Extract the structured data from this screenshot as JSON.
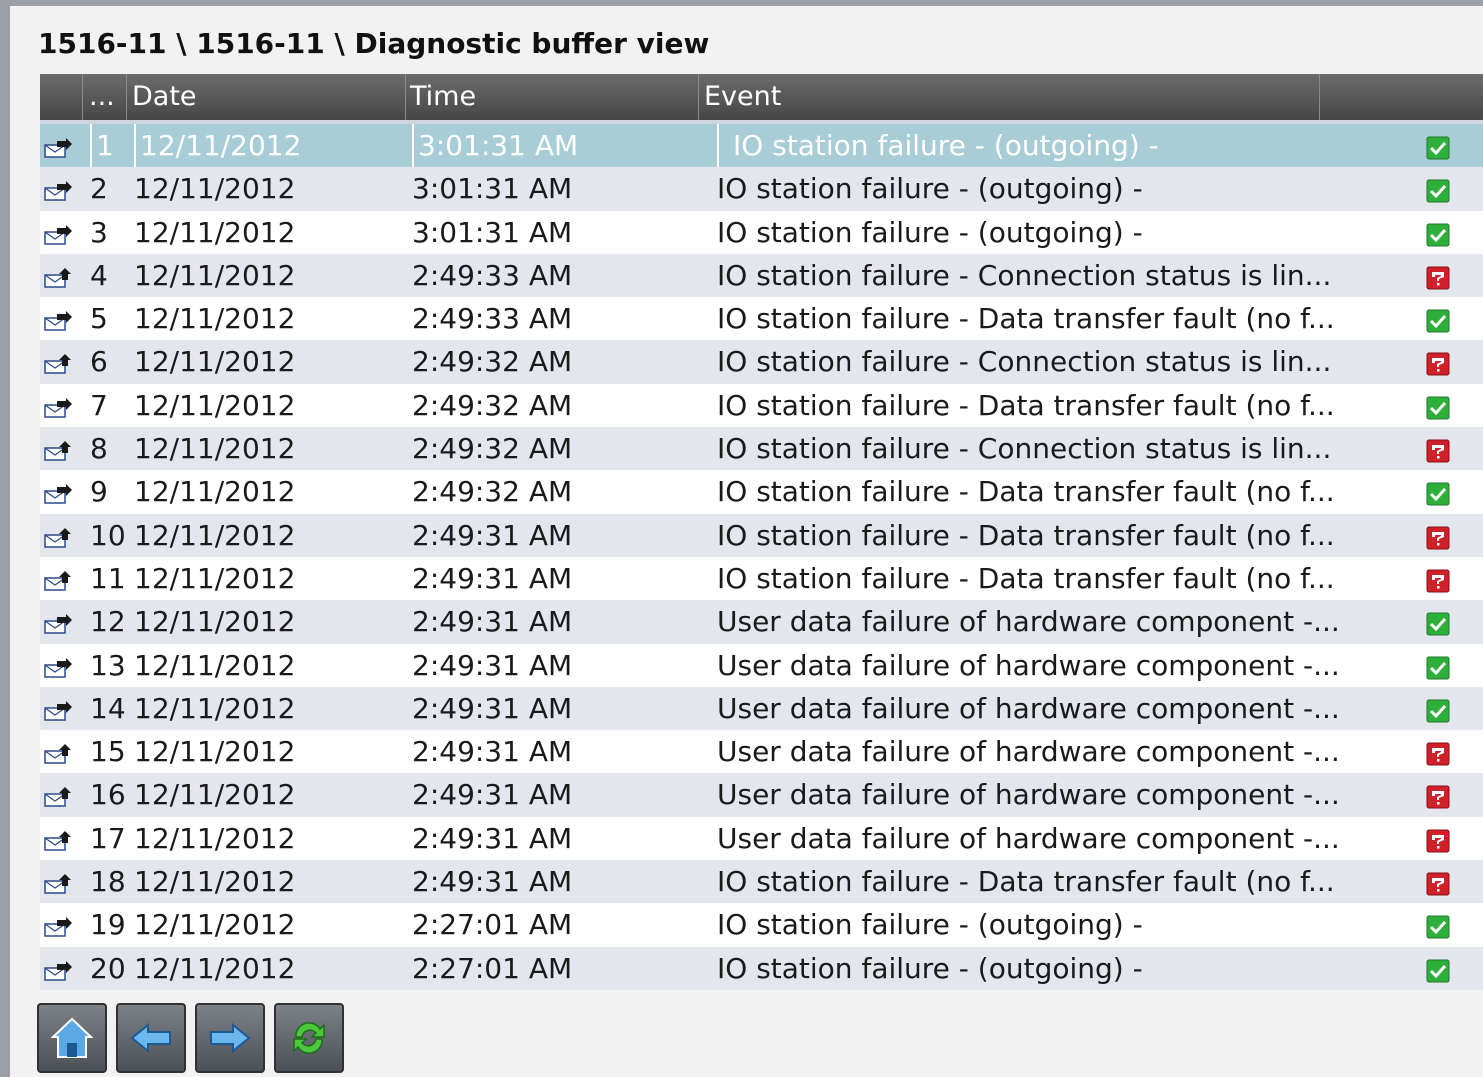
{
  "window": {
    "title": "1516-11 \\ 1516-11 \\ Diagnostic buffer view"
  },
  "table": {
    "columns": [
      "",
      "...",
      "Date",
      "Time",
      "Event",
      ""
    ],
    "rows": [
      {
        "num": "1",
        "date": "12/11/2012",
        "time": "3:01:31 AM",
        "event": "IO station failure - (outgoing) -",
        "direction": "outgoing",
        "status": "ok",
        "selected": true
      },
      {
        "num": "2",
        "date": "12/11/2012",
        "time": "3:01:31 AM",
        "event": "IO station failure - (outgoing) -",
        "direction": "outgoing",
        "status": "ok"
      },
      {
        "num": "3",
        "date": "12/11/2012",
        "time": "3:01:31 AM",
        "event": "IO station failure - (outgoing) -",
        "direction": "outgoing",
        "status": "ok"
      },
      {
        "num": "4",
        "date": "12/11/2012",
        "time": "2:49:33 AM",
        "event": "IO station failure - Connection status is lin...",
        "direction": "incoming",
        "status": "error"
      },
      {
        "num": "5",
        "date": "12/11/2012",
        "time": "2:49:33 AM",
        "event": "IO station failure - Data transfer fault (no f...",
        "direction": "outgoing",
        "status": "ok"
      },
      {
        "num": "6",
        "date": "12/11/2012",
        "time": "2:49:32 AM",
        "event": "IO station failure - Connection status is lin...",
        "direction": "incoming",
        "status": "error"
      },
      {
        "num": "7",
        "date": "12/11/2012",
        "time": "2:49:32 AM",
        "event": "IO station failure - Data transfer fault (no f...",
        "direction": "outgoing",
        "status": "ok"
      },
      {
        "num": "8",
        "date": "12/11/2012",
        "time": "2:49:32 AM",
        "event": "IO station failure - Connection status is lin...",
        "direction": "incoming",
        "status": "error"
      },
      {
        "num": "9",
        "date": "12/11/2012",
        "time": "2:49:32 AM",
        "event": "IO station failure - Data transfer fault (no f...",
        "direction": "outgoing",
        "status": "ok"
      },
      {
        "num": "10",
        "date": "12/11/2012",
        "time": "2:49:31 AM",
        "event": "IO station failure - Data transfer fault (no f...",
        "direction": "incoming",
        "status": "error"
      },
      {
        "num": "11",
        "date": "12/11/2012",
        "time": "2:49:31 AM",
        "event": "IO station failure - Data transfer fault (no f...",
        "direction": "incoming",
        "status": "error"
      },
      {
        "num": "12",
        "date": "12/11/2012",
        "time": "2:49:31 AM",
        "event": "User data failure of hardware component -...",
        "direction": "outgoing",
        "status": "ok"
      },
      {
        "num": "13",
        "date": "12/11/2012",
        "time": "2:49:31 AM",
        "event": "User data failure of hardware component -...",
        "direction": "outgoing",
        "status": "ok"
      },
      {
        "num": "14",
        "date": "12/11/2012",
        "time": "2:49:31 AM",
        "event": "User data failure of hardware component -...",
        "direction": "outgoing",
        "status": "ok"
      },
      {
        "num": "15",
        "date": "12/11/2012",
        "time": "2:49:31 AM",
        "event": "User data failure of hardware component -...",
        "direction": "incoming",
        "status": "error"
      },
      {
        "num": "16",
        "date": "12/11/2012",
        "time": "2:49:31 AM",
        "event": "User data failure of hardware component -...",
        "direction": "incoming",
        "status": "error"
      },
      {
        "num": "17",
        "date": "12/11/2012",
        "time": "2:49:31 AM",
        "event": "User data failure of hardware component -...",
        "direction": "incoming",
        "status": "error"
      },
      {
        "num": "18",
        "date": "12/11/2012",
        "time": "2:49:31 AM",
        "event": "IO station failure - Data transfer fault (no f...",
        "direction": "incoming",
        "status": "error"
      },
      {
        "num": "19",
        "date": "12/11/2012",
        "time": "2:27:01 AM",
        "event": "IO station failure - (outgoing) -",
        "direction": "outgoing",
        "status": "ok"
      },
      {
        "num": "20",
        "date": "12/11/2012",
        "time": "2:27:01 AM",
        "event": "IO station failure - (outgoing) -",
        "direction": "outgoing",
        "status": "ok"
      }
    ]
  },
  "toolbar": {
    "buttons": [
      {
        "name": "home-button",
        "icon": "home-icon"
      },
      {
        "name": "back-button",
        "icon": "arrow-left-icon"
      },
      {
        "name": "forward-button",
        "icon": "arrow-right-icon"
      },
      {
        "name": "refresh-button",
        "icon": "refresh-icon"
      }
    ]
  },
  "colors": {
    "header_bg": "#555555",
    "row_alt": "#e4e6ee",
    "row_selected": "#a8cdd6",
    "status_ok": "#2eae3a",
    "status_error": "#d0202a"
  }
}
